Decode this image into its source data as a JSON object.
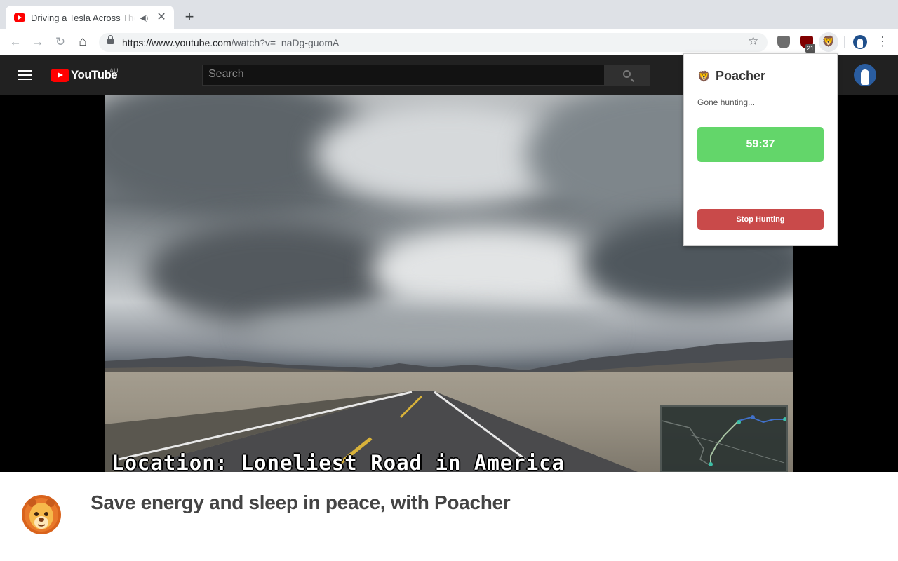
{
  "browser": {
    "tab": {
      "title": "Driving a Tesla Across The",
      "audio_icon": "speaker-icon",
      "close_glyph": "✕"
    },
    "new_tab_glyph": "+",
    "nav": {
      "back": "←",
      "forward": "→",
      "reload": "↻",
      "home": "⌂"
    },
    "url_main": "https://www.youtube.com",
    "url_rest": "/watch?v=_naDg-guomA",
    "star_glyph": "☆",
    "extensions": {
      "ublock_badge": "21"
    },
    "menu_glyph": "⋮"
  },
  "youtube": {
    "logo_text": "YouTube",
    "region": "AU",
    "search_placeholder": "Search"
  },
  "video": {
    "caption": "Location: Loneliest Road in America"
  },
  "popup": {
    "logo": "🦁",
    "title": "Poacher",
    "status": "Gone hunting...",
    "timer": "59:37",
    "stop_label": "Stop Hunting",
    "colors": {
      "timer": "#63d66a",
      "stop": "#c94a4a"
    }
  },
  "promo": {
    "tagline": "Save energy and sleep in peace, with Poacher"
  }
}
